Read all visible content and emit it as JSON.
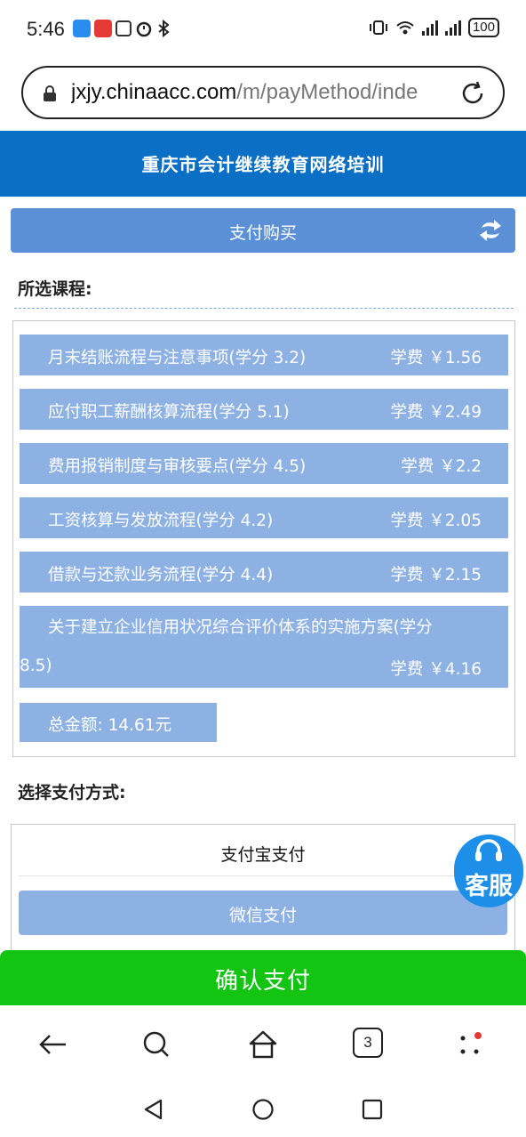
{
  "status_bar": {
    "time": "5:46",
    "battery": "100"
  },
  "url_bar": {
    "domain": "jxjy.chinaacc.com",
    "path": "/m/payMethod/inde"
  },
  "site": {
    "title": "重庆市会计继续教育网络培训"
  },
  "page": {
    "pay_header": "支付购买",
    "selected_courses_label": "所选课程:",
    "payment_method_label": "选择支付方式:"
  },
  "courses": [
    {
      "name": "月末结账流程与注意事项(学分 3.2)",
      "fee": "学费 ￥1.56"
    },
    {
      "name": "应付职工薪酬核算流程(学分 5.1)",
      "fee": "学费 ￥2.49"
    },
    {
      "name": "费用报销制度与审核要点(学分 4.5)",
      "fee": "学费 ￥2.2"
    },
    {
      "name": "工资核算与发放流程(学分 4.2)",
      "fee": "学费 ￥2.05"
    },
    {
      "name": "借款与还款业务流程(学分 4.4)",
      "fee": "学费 ￥2.15"
    },
    {
      "name_line1": "关于建立企业信用状况综合评价体系的实施方案(学分",
      "name_line2": "8.5)",
      "fee": "学费 ￥4.16"
    }
  ],
  "total": "总金额: 14.61元",
  "payment_methods": {
    "alipay": "支付宝支付",
    "wechat": "微信支付"
  },
  "customer_service": "客服",
  "confirm_button": "确认支付",
  "browser_toolbar": {
    "tabs_count": "3"
  },
  "colors": {
    "header_blue": "#0b6fc6",
    "item_blue": "#8db1e3",
    "pay_header_blue": "#5b8fd6",
    "confirm_green": "#13c413",
    "cs_blue": "#1e8fe8"
  }
}
